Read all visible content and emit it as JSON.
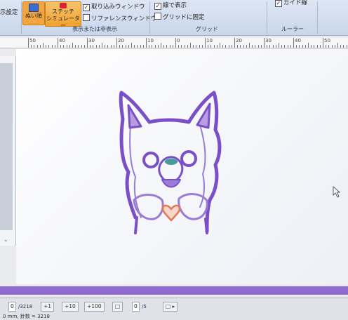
{
  "ribbon": {
    "partial_left_label": "示設定",
    "nuijun_label": "ぬい順",
    "stitch_sim_label_1": "ステッチ",
    "stitch_sim_label_2": "シミュレーター",
    "checkbox_import_window": "取り込みウィンドウ",
    "checkbox_reference_window": "リファレンスウィンドウ",
    "group_display_label": "表示または非表示",
    "checkbox_line_display": "線で表示",
    "checkbox_grid_fix": "グリッドに固定",
    "group_grid_label": "グリッド",
    "checkbox_guide_line": "ガイド線",
    "group_ruler_label": "ルーラー"
  },
  "ruler": {
    "labels": [
      "50",
      "40",
      "30",
      "20",
      "10",
      "0",
      "10",
      "20",
      "30",
      "40",
      "50"
    ]
  },
  "status_bar": {
    "stitch_field": "0",
    "stitch_total": "/3218",
    "btn_plus1": "+1",
    "btn_plus10": "+10",
    "btn_plus100": "+100",
    "color_field": "0",
    "color_total": "/5",
    "bottom_text": "0 mm, 針数 = 3218"
  },
  "design": {
    "outline_color": "#7a4fc8",
    "ear_fill": "#b79ee0",
    "mouth_fill": "#9a7cd6",
    "heart_color": "#e07a58",
    "teal_accent": "#4a9a9a"
  },
  "colors": {
    "scrollbar": "#8f6bd0",
    "ribbon_active": "#f3a640"
  }
}
